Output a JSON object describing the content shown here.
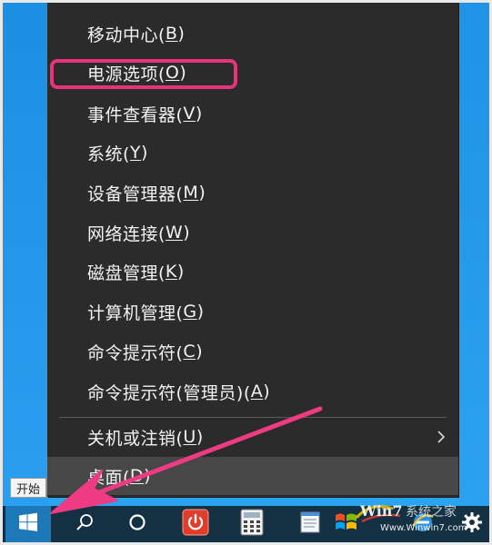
{
  "context_menu": {
    "items": [
      {
        "label": "移动中心(",
        "key": "B",
        "tail": ")"
      },
      {
        "label": "电源选项(",
        "key": "O",
        "tail": ")"
      },
      {
        "label": "事件查看器(",
        "key": "V",
        "tail": ")"
      },
      {
        "label": "系统(",
        "key": "Y",
        "tail": ")"
      },
      {
        "label": "设备管理器(",
        "key": "M",
        "tail": ")"
      },
      {
        "label": "网络连接(",
        "key": "W",
        "tail": ")"
      },
      {
        "label": "磁盘管理(",
        "key": "K",
        "tail": ")"
      },
      {
        "label": "计算机管理(",
        "key": "G",
        "tail": ")"
      },
      {
        "label": "命令提示符(",
        "key": "C",
        "tail": ")"
      },
      {
        "label": "命令提示符(管理员)(",
        "key": "A",
        "tail": ")"
      },
      {
        "label": "关机或注销(",
        "key": "U",
        "tail": ")"
      },
      {
        "label": "桌面(",
        "key": "D",
        "tail": ")"
      }
    ],
    "highlighted_item": "电源选项(O)"
  },
  "tooltip": {
    "text": "开始"
  },
  "taskbar": {
    "icons": [
      "windows-start-icon",
      "search-icon",
      "task-view-icon",
      "power-app-icon",
      "calculator-icon",
      "notepad-icon",
      "windows-flag-icon",
      "ie-icon",
      "settings-gear-icon"
    ]
  },
  "colors": {
    "menu_bg": "#2b2b2b",
    "menu_text": "#f2f2f2",
    "highlight": "#e8327a",
    "desktop": "#1f9aee",
    "taskbar": "#143043"
  }
}
